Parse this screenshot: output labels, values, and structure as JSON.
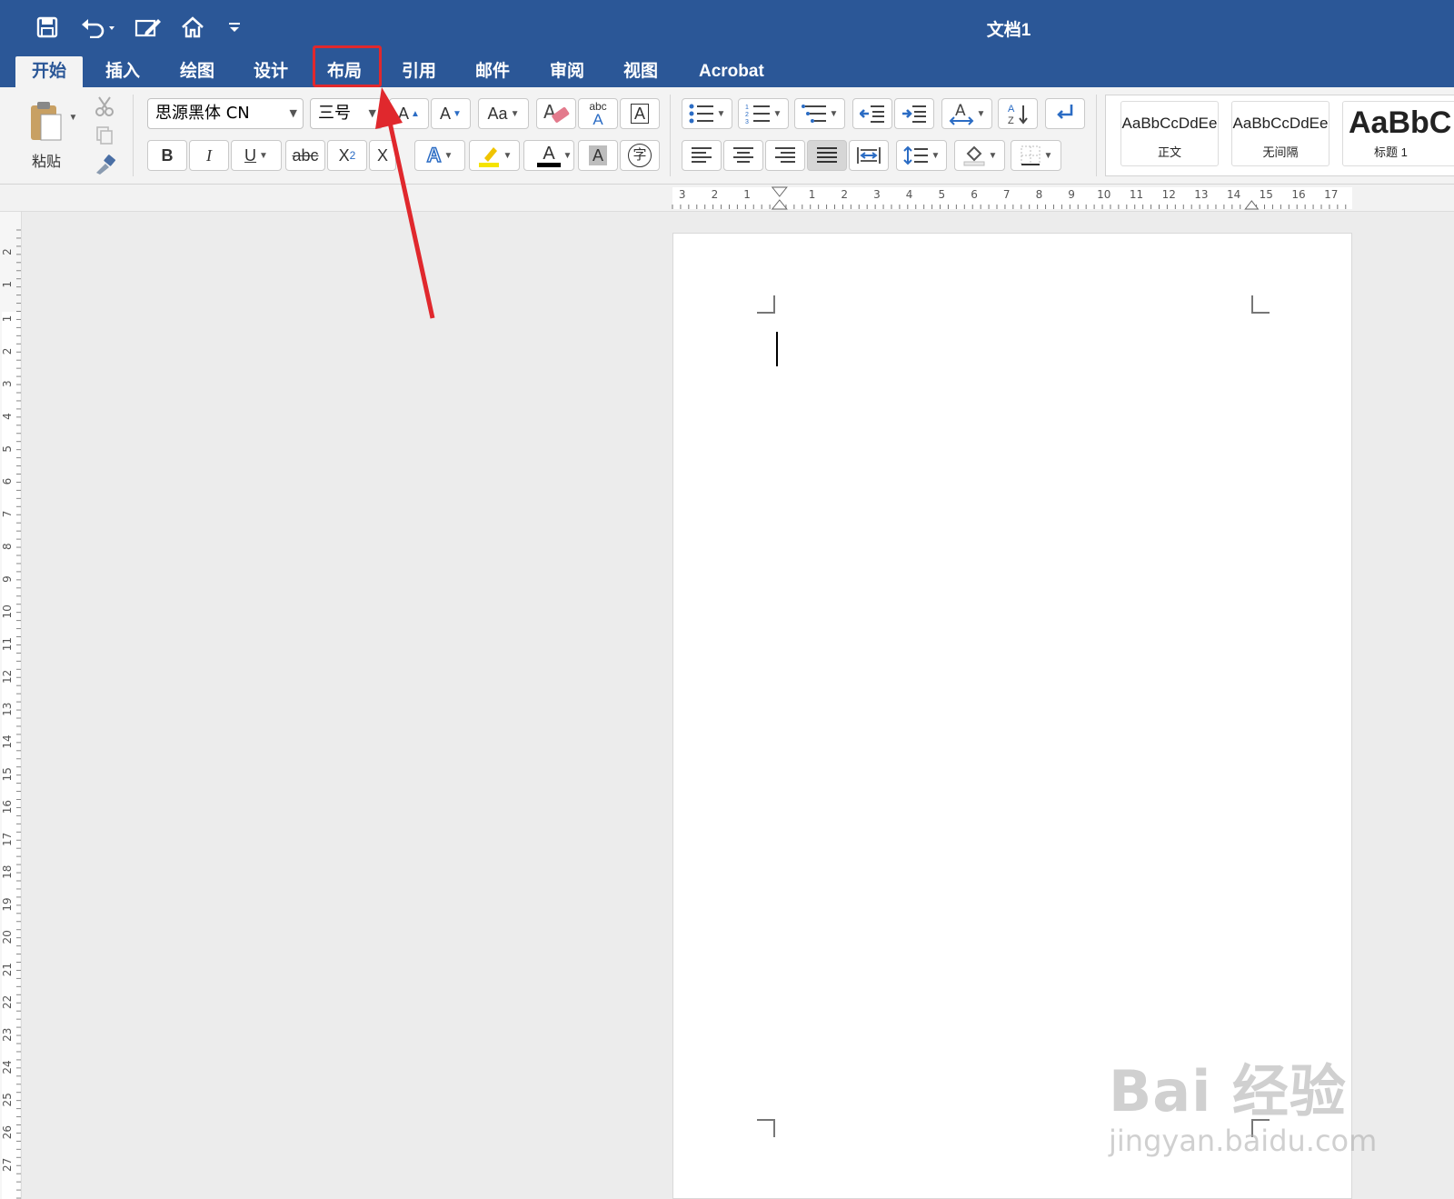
{
  "window": {
    "title": "文档1"
  },
  "quick_access": {
    "save_icon": "save-icon",
    "undo_icon": "undo-icon",
    "edit_icon": "edit-document-icon",
    "home_icon": "home-icon",
    "customize_icon": "customize-toolbar-icon"
  },
  "tabs": [
    {
      "label": "开始",
      "active": true
    },
    {
      "label": "插入"
    },
    {
      "label": "绘图"
    },
    {
      "label": "设计"
    },
    {
      "label": "布局",
      "highlighted": true
    },
    {
      "label": "引用"
    },
    {
      "label": "邮件"
    },
    {
      "label": "审阅"
    },
    {
      "label": "视图"
    },
    {
      "label": "Acrobat"
    }
  ],
  "clipboard": {
    "paste_label": "粘贴"
  },
  "font": {
    "name": "思源黑体 CN",
    "size": "三号"
  },
  "format_buttons": {
    "bold": "B",
    "italic": "I",
    "underline": "U",
    "strike": "abc",
    "subscript": "X",
    "subscript_mark": "2",
    "superscript": "X",
    "grow": "A",
    "shrink": "A",
    "case": "Aa",
    "phonetic_top": "abc",
    "phonetic_bottom": "A",
    "border_char": "A",
    "text_effect": "A",
    "font_color": "A",
    "shading_char": "A",
    "enclose_char": "字"
  },
  "styles": [
    {
      "sample": "AaBbCcDdEe",
      "label": "正文"
    },
    {
      "sample": "AaBbCcDdEe",
      "label": "无间隔"
    },
    {
      "sample": "AaBbC",
      "label": "标题 1"
    }
  ],
  "ruler": {
    "horizontal_labels": [
      "3",
      "2",
      "1",
      "1",
      "2",
      "3",
      "4",
      "5",
      "6",
      "7",
      "8",
      "9",
      "10",
      "11",
      "12",
      "13",
      "14",
      "15",
      "16",
      "17"
    ],
    "vertical_labels": [
      "2",
      "1",
      "1",
      "2",
      "3",
      "4",
      "5",
      "6",
      "7",
      "8",
      "9",
      "10",
      "11",
      "12",
      "13",
      "14",
      "15",
      "16",
      "17",
      "18",
      "19",
      "20",
      "21",
      "22",
      "23",
      "24",
      "25",
      "26",
      "27"
    ]
  },
  "watermark": {
    "brand": "Bai 经验",
    "url": "jingyan.baidu.com"
  },
  "colors": {
    "title_bar": "#2b5797",
    "highlight_box": "#e0282d",
    "arrow": "#e0282d",
    "highlight_yellow": "#f5e400"
  }
}
